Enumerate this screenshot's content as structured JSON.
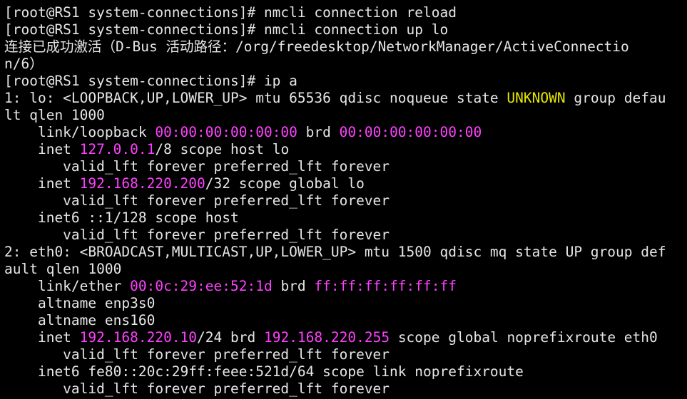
{
  "colors": {
    "background": "#000000",
    "text": "#e6e6e6",
    "address": "#ff40ff",
    "state_unknown": "#e5e500"
  },
  "terminal": {
    "lines": [
      [
        {
          "t": "[root@RS1 system-connections]# nmcli connection reload"
        }
      ],
      [
        {
          "t": "[root@RS1 system-connections]# nmcli connection up lo"
        }
      ],
      [
        {
          "t": "连接已成功激活（",
          "c": "cjk"
        },
        {
          "t": "D-Bus "
        },
        {
          "t": "活动路径：",
          "c": "cjk"
        },
        {
          "t": "/org/freedesktop/NetworkManager/ActiveConnectio"
        }
      ],
      [
        {
          "t": "n/6"
        },
        {
          "t": "）",
          "c": "cjk"
        }
      ],
      [
        {
          "t": "[root@RS1 system-connections]# ip a"
        }
      ],
      [
        {
          "t": "1: lo: <LOOPBACK,UP,LOWER_UP> mtu 65536 qdisc noqueue state "
        },
        {
          "t": "UNKNOWN",
          "c": "yel"
        },
        {
          "t": " group defau"
        }
      ],
      [
        {
          "t": "lt qlen 1000"
        }
      ],
      [
        {
          "t": "    link/loopback "
        },
        {
          "t": "00:00:00:00:00:00",
          "c": "mag"
        },
        {
          "t": " brd "
        },
        {
          "t": "00:00:00:00:00:00",
          "c": "mag"
        }
      ],
      [
        {
          "t": "    inet "
        },
        {
          "t": "127.0.0.1",
          "c": "mag"
        },
        {
          "t": "/8 scope host lo"
        }
      ],
      [
        {
          "t": "       valid_lft forever preferred_lft forever"
        }
      ],
      [
        {
          "t": "    inet "
        },
        {
          "t": "192.168.220.200",
          "c": "mag"
        },
        {
          "t": "/32 scope global lo"
        }
      ],
      [
        {
          "t": "       valid_lft forever preferred_lft forever"
        }
      ],
      [
        {
          "t": "    inet6 ::1/128 scope host"
        }
      ],
      [
        {
          "t": "       valid_lft forever preferred_lft forever"
        }
      ],
      [
        {
          "t": "2: eth0: <BROADCAST,MULTICAST,UP,LOWER_UP> mtu 1500 qdisc mq state UP group def"
        }
      ],
      [
        {
          "t": "ault qlen 1000"
        }
      ],
      [
        {
          "t": "    link/ether "
        },
        {
          "t": "00:0c:29:ee:52:1d",
          "c": "mag"
        },
        {
          "t": " brd "
        },
        {
          "t": "ff:ff:ff:ff:ff:ff",
          "c": "mag"
        }
      ],
      [
        {
          "t": "    altname enp3s0"
        }
      ],
      [
        {
          "t": "    altname ens160"
        }
      ],
      [
        {
          "t": "    inet "
        },
        {
          "t": "192.168.220.10",
          "c": "mag"
        },
        {
          "t": "/24 brd "
        },
        {
          "t": "192.168.220.255",
          "c": "mag"
        },
        {
          "t": " scope global noprefixroute eth0"
        }
      ],
      [
        {
          "t": "       valid_lft forever preferred_lft forever"
        }
      ],
      [
        {
          "t": "    inet6 fe80::20c:29ff:feee:521d/64 scope link noprefixroute"
        }
      ],
      [
        {
          "t": "       valid_lft forever preferred_lft forever"
        }
      ]
    ]
  }
}
